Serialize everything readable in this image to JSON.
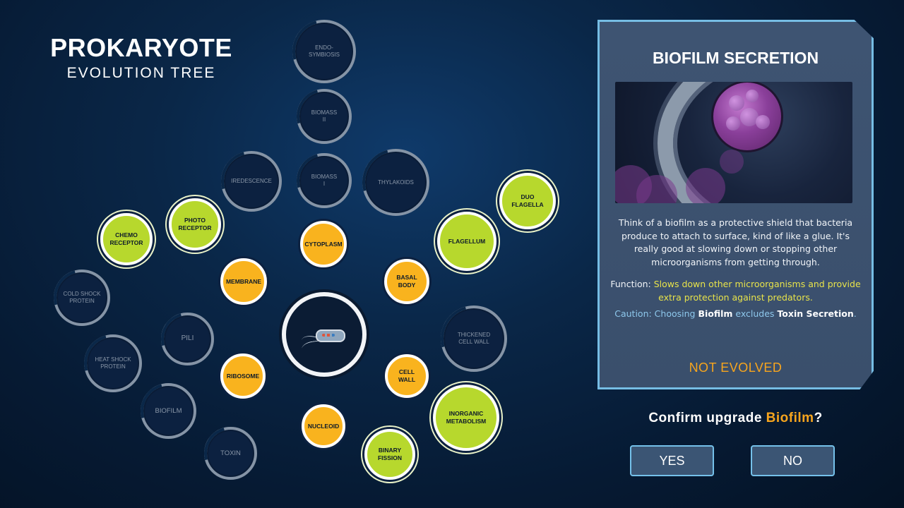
{
  "title": {
    "line1": "PROKARYOTE",
    "line2": "EVOLUTION TREE"
  },
  "tree_nodes": {
    "endosymbiosis": "ENDO-\nSYMBIOSIS",
    "biomass2": "BIOMASS\nII",
    "biomass1": "BIOMASS\nI",
    "iredescence": "IREDESCENCE",
    "thylakoids": "THYLAKOIDS",
    "photo_receptor": "PHOTO\nRECEPTOR",
    "chemo_receptor": "CHEMO\nRECEPTOR",
    "cytoplasm": "CYTOPLASM",
    "duo_flagella": "DUO\nFLAGELLA",
    "flagellum": "FLAGELLUM",
    "membrane": "MEMBRANE",
    "basal_body": "BASAL\nBODY",
    "cold_shock": "COLD SHOCK\nPROTEIN",
    "pili": "PILI",
    "thickened_cell_wall": "THICKENED\nCELL WALL",
    "heat_shock": "HEAT SHOCK\nPROTEIN",
    "ribosome": "RIBOSOME",
    "cell_wall": "CELL WALL",
    "biofilm": "BIOFILM",
    "inorganic_metabolism": "INORGANIC\nMETABOLISM",
    "nucleoid": "NUCLEOID",
    "toxin": "TOXIN",
    "binary_fission": "BINARY\nFISSION"
  },
  "panel": {
    "title": "BIOFILM SECRETION",
    "description": "Think of a biofilm as a protective shield that bacteria produce to attach to surface, kind of like a glue. It's really good at slowing down or stopping other microorganisms from getting through.",
    "function_label": "Function: ",
    "function_text": "Slows down other microorganisms and provide extra protection against predators.",
    "caution_prefix": "Caution: Choosing ",
    "caution_item": "Biofilm",
    "caution_mid": " excludes ",
    "caution_excluded": "Toxin Secretion",
    "caution_end": ".",
    "status": "NOT EVOLVED"
  },
  "confirm": {
    "prefix": "Confirm upgrade ",
    "item": "Biofilm",
    "suffix": "?"
  },
  "buttons": {
    "yes": "YES",
    "no": "NO"
  },
  "colors": {
    "accent_border": "#76bde4",
    "evolved_green": "#b7d82d",
    "available_orange": "#f9b31e",
    "status_orange": "#f7a51d",
    "function_yellow": "#e8e34a"
  }
}
